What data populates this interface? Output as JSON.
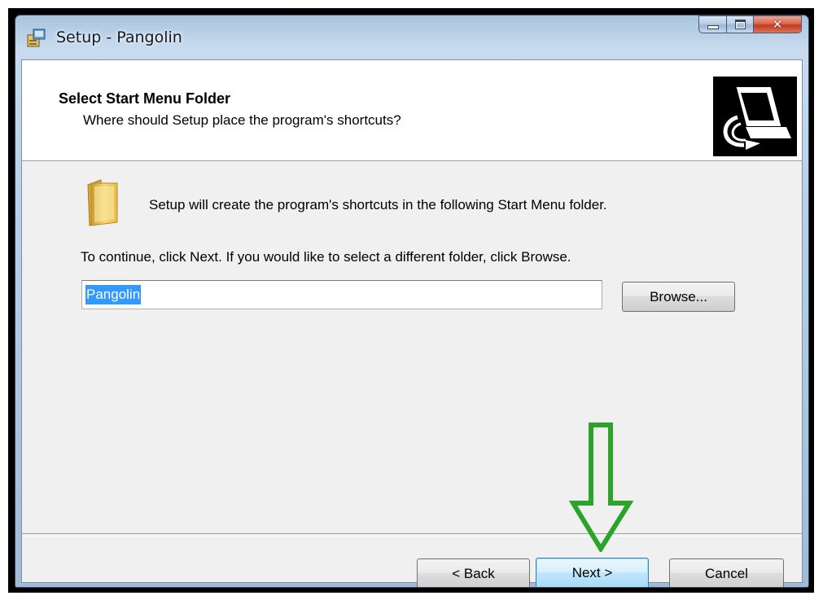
{
  "window": {
    "title": "Setup - Pangolin",
    "title_icon": "setup-installer-icon",
    "controls": {
      "minimize": "minimize-icon",
      "maximize": "maximize-icon",
      "close": "close-icon"
    }
  },
  "header": {
    "title": "Select Start Menu Folder",
    "subtitle": "Where should Setup place the program's shortcuts?",
    "image": "computer-wizard-icon"
  },
  "main": {
    "folder_icon": "folder-icon",
    "info_text": "Setup will create the program's shortcuts in the following Start Menu folder.",
    "continue_text": "To continue, click Next. If you would like to select a different folder, click Browse.",
    "folder_field": {
      "value": "Pangolin",
      "selected": true
    },
    "browse_label": "Browse..."
  },
  "footer": {
    "back_label": "< Back",
    "next_label": "Next >",
    "cancel_label": "Cancel"
  },
  "annotation": {
    "arrow": "green-down-arrow",
    "color": "#2aa52a"
  },
  "colors": {
    "selection": "#3399ff",
    "default_button_border": "#3c7fb1",
    "dialog_background": "#f0f0f0"
  }
}
